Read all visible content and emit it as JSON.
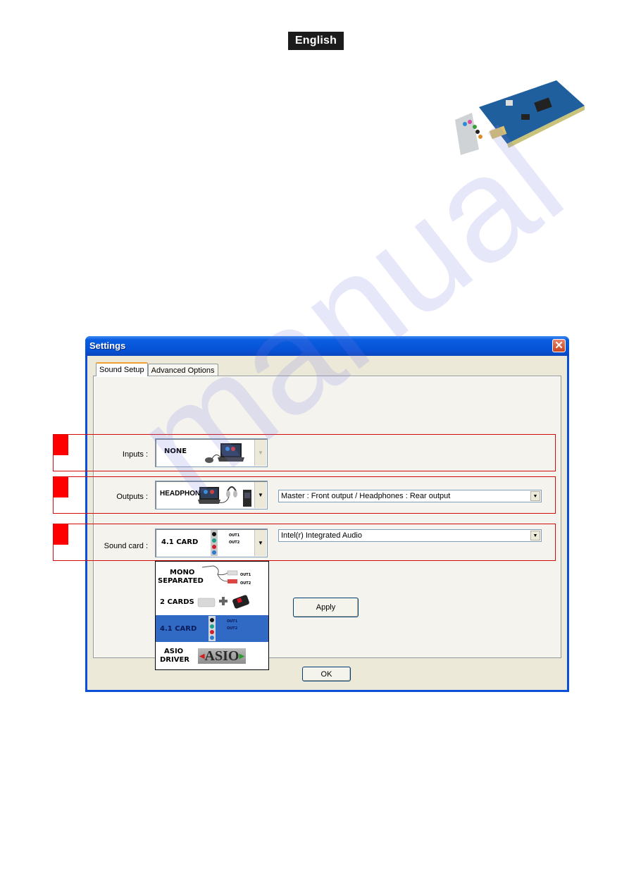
{
  "page": {
    "language_badge": "English"
  },
  "window": {
    "title": "Settings",
    "close_icon": "close-x-icon",
    "tabs": [
      {
        "label": "Sound Setup",
        "active": true
      },
      {
        "label": "Advanced Options",
        "active": false
      }
    ],
    "inputs": {
      "label": "Inputs :",
      "picker_value": "NONE",
      "picker_enabled": false
    },
    "outputs": {
      "label": "Outputs :",
      "picker_value": "HEADPHONES",
      "routing_value": "Master : Front output / Headphones : Rear output"
    },
    "sound_card": {
      "label": "Sound card :",
      "picker_value": "4.1 CARD",
      "device_value": "Intel(r) Integrated Audio",
      "out_labels": [
        "OUT1",
        "OUT2"
      ],
      "options": [
        {
          "label_line1": "MONO",
          "label_line2": "SEPARATED",
          "out_labels": [
            "OUT1",
            "OUT2"
          ],
          "selected": false
        },
        {
          "label_line1": "2 CARDS",
          "label_line2": "",
          "selected": false
        },
        {
          "label_line1": "4.1 CARD",
          "label_line2": "",
          "out_labels": [
            "OUT1",
            "OUT2"
          ],
          "selected": true
        },
        {
          "label_line1": "ASIO",
          "label_line2": "DRIVER",
          "logo_text": "ASIO",
          "selected": false
        }
      ]
    },
    "apply_button": "Apply",
    "ok_button": "OK"
  },
  "colors": {
    "highlight_box": "#d20a0a",
    "selection": "#316ac5",
    "titlebar": "#0752d6"
  }
}
